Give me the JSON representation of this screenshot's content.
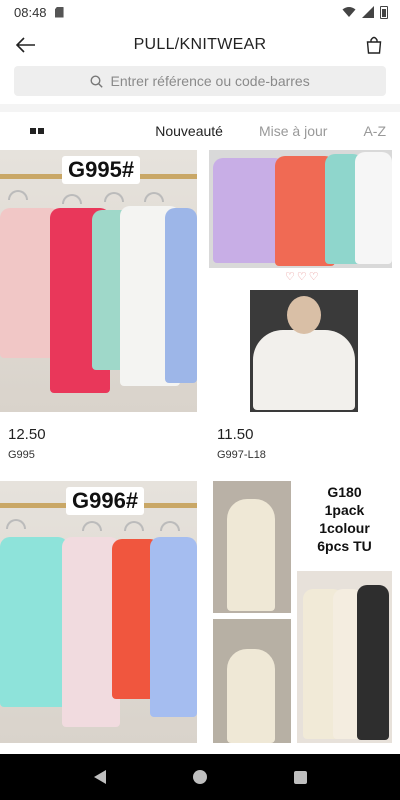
{
  "status_bar": {
    "time": "08:48"
  },
  "header": {
    "title": "PULL/KNITWEAR"
  },
  "search": {
    "placeholder": "Entrer référence ou code-barres"
  },
  "sort": {
    "options": [
      "Nouveauté",
      "Mise à jour",
      "A-Z"
    ],
    "active": "Nouveauté"
  },
  "products": [
    {
      "price": "12.50",
      "ref": "G995",
      "image_label": "G995#"
    },
    {
      "price": "11.50",
      "ref": "G997-L18",
      "image_label": "♡♡♡"
    },
    {
      "image_label": "G996#"
    },
    {
      "image_label": "G180\n1pack\n1colour\n6pcs TU"
    }
  ],
  "colors": {
    "accent": "#222222",
    "inactive": "#999999",
    "search_bg": "#eeeeee",
    "nav_bar": "#000000"
  },
  "icons": {
    "back": "arrow-left-icon",
    "bag": "shopping-bag-icon",
    "search": "search-icon",
    "view": "grid-view-icon"
  }
}
